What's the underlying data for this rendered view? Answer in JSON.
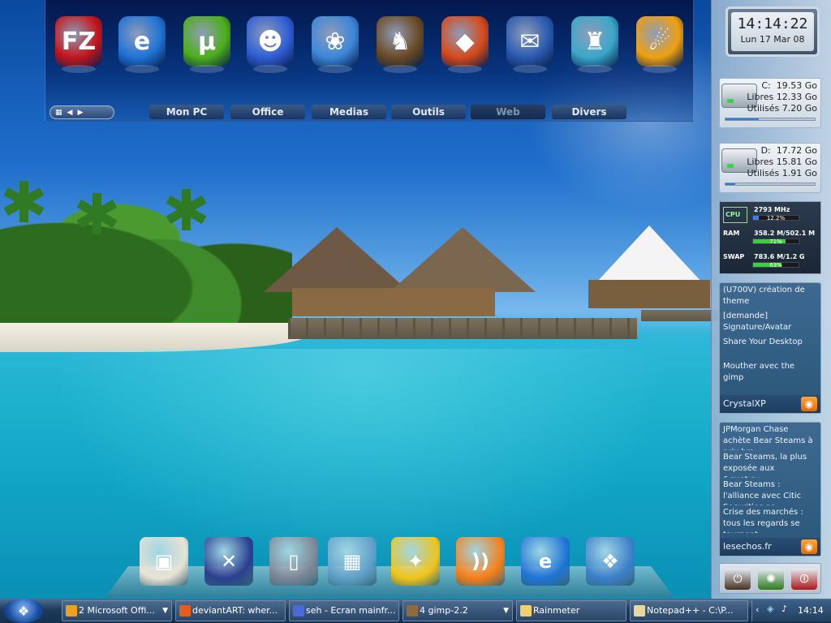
{
  "launcher": {
    "tabs": [
      {
        "label": "Mon PC",
        "active": false
      },
      {
        "label": "Office",
        "active": false
      },
      {
        "label": "Medias",
        "active": false
      },
      {
        "label": "Outils",
        "active": false
      },
      {
        "label": "Web",
        "active": true
      },
      {
        "label": "Divers",
        "active": false
      }
    ],
    "icons": [
      {
        "name": "filezilla-icon",
        "glyph": "FZ",
        "color": "#c4161c"
      },
      {
        "name": "internet-explorer-icon",
        "glyph": "e",
        "color": "#1e73d6"
      },
      {
        "name": "utorrent-icon",
        "glyph": "µ",
        "color": "#4caf1a"
      },
      {
        "name": "messenger-icon",
        "glyph": "☻",
        "color": "#2f5ed4"
      },
      {
        "name": "frog-icon",
        "glyph": "❀",
        "color": "#3c86d9"
      },
      {
        "name": "dog-icon",
        "glyph": "♞",
        "color": "#6b4b24"
      },
      {
        "name": "mask-icon",
        "glyph": "◆",
        "color": "#d64a1a"
      },
      {
        "name": "thunderbird-icon",
        "glyph": "✉",
        "color": "#2a5ab0"
      },
      {
        "name": "elephant-icon",
        "glyph": "♜",
        "color": "#3aa7c9"
      },
      {
        "name": "comet-icon",
        "glyph": "☄",
        "color": "#f0a010"
      }
    ],
    "nav_icons": [
      "grip-icon",
      "prev-arrow-icon",
      "next-arrow-icon"
    ]
  },
  "clock": {
    "time": "14:14:22",
    "date": "Lun 17 Mar 08"
  },
  "drives": [
    {
      "letter": "C:",
      "total": "19.53 Go",
      "free": "12.33 Go",
      "used": "7.20 Go",
      "used_fraction": 0.37
    },
    {
      "letter": "D:",
      "total": "17.72 Go",
      "free": "15.81 Go",
      "used": "1.91 Go",
      "used_fraction": 0.11
    }
  ],
  "drive_labels": {
    "free": "Libres",
    "used": "Utilisés"
  },
  "sysmon": {
    "cpu": {
      "tag": "CPU",
      "freq": "2793 MHz",
      "percent_label": "12.2%",
      "fraction": 0.122
    },
    "ram": {
      "tag": "RAM",
      "value": "358.2 M/502.1 M",
      "percent_label": "71%",
      "fraction": 0.71
    },
    "swap": {
      "tag": "SWAP",
      "value": "783.6 M/1.2 G",
      "percent_label": "63%",
      "fraction": 0.63
    }
  },
  "feeds": [
    {
      "source": "CrystalXP",
      "items": [
        "(U700V) création de theme",
        "[demande] Signature/Avatar",
        "Share Your Desktop",
        "Mouther avec the gimp"
      ]
    },
    {
      "source": "lesechos.fr",
      "items": [
        "JPMorgan Chase achète Bear Steams à prix bra...",
        "Bear Steams, la plus exposée aux &quot;su...",
        "Bear Steams : l'alliance avec Citic Securities pa...",
        "Crise des marchés : tous les regards se tournent..."
      ]
    }
  ],
  "power": [
    {
      "name": "power-button",
      "glyph": "⏻",
      "color": "#4a3020"
    },
    {
      "name": "restart-button",
      "glyph": "✺",
      "color": "#2f7d1e"
    },
    {
      "name": "shutdown-button",
      "glyph": "⏼",
      "color": "#b01818"
    }
  ],
  "dock": [
    {
      "name": "office-icon",
      "glyph": "▣",
      "color": "#e8e2d4"
    },
    {
      "name": "tools-icon",
      "glyph": "✕",
      "color": "#2a3f8f"
    },
    {
      "name": "ipod-icon",
      "glyph": "▯",
      "color": "#7c8796"
    },
    {
      "name": "desktop-picture-icon",
      "glyph": "▦",
      "color": "#5e9fc9"
    },
    {
      "name": "settings-hex-icon",
      "glyph": "✦",
      "color": "#f0c419"
    },
    {
      "name": "rss-icon",
      "glyph": "))",
      "color": "#f57e18"
    },
    {
      "name": "ie-dock-icon",
      "glyph": "e",
      "color": "#1e73d6"
    },
    {
      "name": "windows-icon",
      "glyph": "❖",
      "color": "#3a7fc9"
    }
  ],
  "taskbar": {
    "tasks": [
      {
        "label": "2 Microsoft Offi...",
        "icon": "#f0a020",
        "has_arrow": true
      },
      {
        "label": "deviantART: wher...",
        "icon": "#e65c1a",
        "has_arrow": false
      },
      {
        "label": "seh - Ecran mainfr...",
        "icon": "#4a6ad8",
        "has_arrow": false
      },
      {
        "label": "4 gimp-2.2",
        "icon": "#8f6b3c",
        "has_arrow": true
      },
      {
        "label": "Rainmeter",
        "icon": "#f0d070",
        "has_arrow": false
      },
      {
        "label": "Notepad++ - C:\\P...",
        "icon": "#e8d8a0",
        "has_arrow": false
      }
    ],
    "tray_time": "14:14",
    "tray_icons": [
      "collapse-arrow-icon",
      "tray-app-icon",
      "volume-icon"
    ]
  }
}
